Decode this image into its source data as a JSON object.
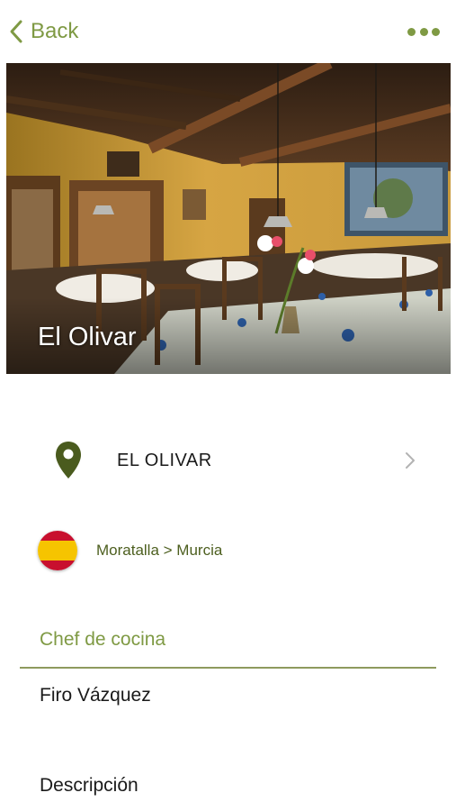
{
  "nav": {
    "back_label": "Back",
    "back_icon": "chevron-left-icon",
    "more_icon": "more-dots-icon",
    "accent_color": "#7f9a44"
  },
  "hero": {
    "title": "El Olivar",
    "image": "restaurant-dining-room-photo"
  },
  "location": {
    "icon": "map-pin-icon",
    "name": "EL OLIVAR",
    "chevron_icon": "chevron-right-icon"
  },
  "region": {
    "flag_icon": "spain-flag-icon",
    "text": "Moratalla > Murcia",
    "text_color": "#4d5f1f"
  },
  "chef": {
    "section_title": "Chef de cocina",
    "name": "Firo Vázquez"
  },
  "description": {
    "label": "Descripción"
  }
}
